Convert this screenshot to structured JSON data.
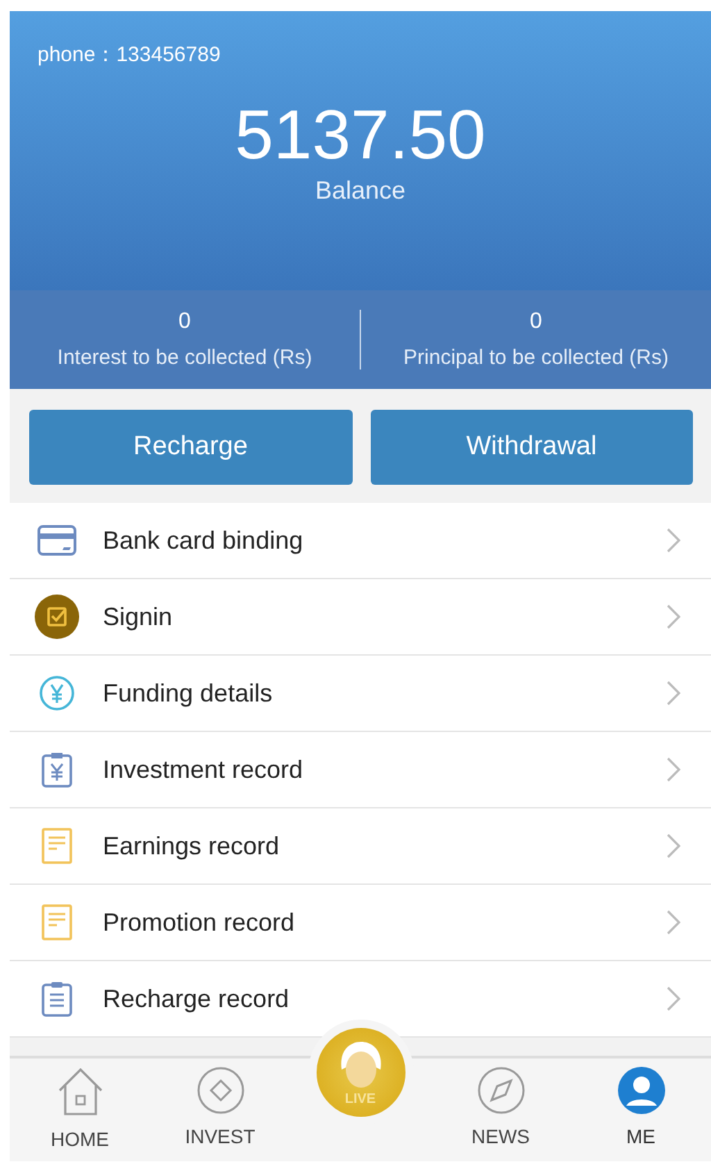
{
  "header": {
    "phone": "phone：133456789",
    "balance": "5137.50",
    "balance_label": "Balance"
  },
  "stats": [
    {
      "value": "0",
      "label": "Interest to be collected (Rs)"
    },
    {
      "value": "0",
      "label": "Principal to be collected (Rs)"
    }
  ],
  "buttons": [
    "Recharge",
    "Withdrawal"
  ],
  "menu": [
    {
      "kind": "card",
      "label": "Bank card binding"
    },
    {
      "kind": "signin",
      "label": "Signin"
    },
    {
      "kind": "funding",
      "label": "Funding details"
    },
    {
      "kind": "investment",
      "label": "Investment record"
    },
    {
      "kind": "earnings",
      "label": "Earnings record"
    },
    {
      "kind": "promotion",
      "label": "Promotion record"
    },
    {
      "kind": "recharge",
      "label": "Recharge record"
    }
  ],
  "nav": [
    {
      "kind": "home",
      "label": "HOME",
      "selected": false
    },
    {
      "kind": "invest",
      "label": "INVEST",
      "selected": false
    },
    {
      "kind": "live",
      "label": "LIVE",
      "selected": false
    },
    {
      "kind": "news",
      "label": "NEWS",
      "selected": false
    },
    {
      "kind": "me",
      "label": "ME",
      "selected": true
    }
  ]
}
